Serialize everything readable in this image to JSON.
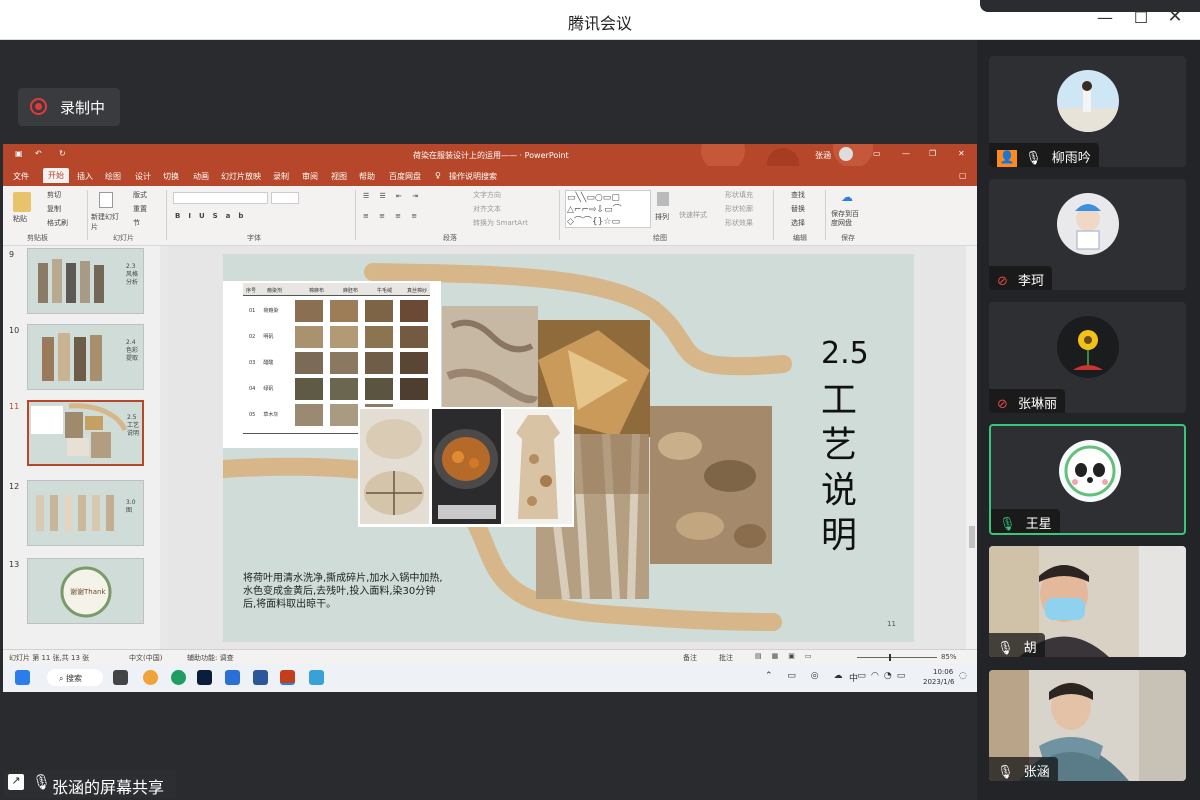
{
  "app": {
    "window_title": "腾讯会议",
    "recording_label": "录制中",
    "share_label": "张涵的屏幕共享"
  },
  "ppt": {
    "title": "荷染在服装设计上的运用—— · PowerPoint",
    "user": "张涵",
    "tabs": [
      "文件",
      "开始",
      "插入",
      "绘图",
      "设计",
      "切换",
      "动画",
      "幻灯片放映",
      "录制",
      "审阅",
      "视图",
      "帮助",
      "百度网盘"
    ],
    "search": "操作说明搜索",
    "ribbon": {
      "clipboard_items": [
        "粘贴",
        "剪切",
        "复制",
        "格式刷"
      ],
      "slides_items": [
        "新建幻灯片",
        "版式",
        "重置",
        "节"
      ],
      "para_items": [
        "文字方向",
        "对齐文本",
        "转换为 SmartArt"
      ],
      "drawing_items": [
        "排列",
        "快速样式",
        "形状填充",
        "形状轮廓",
        "形状效果"
      ],
      "edit_items": [
        "查找",
        "替换",
        "选择"
      ],
      "save_item": "保存到百度网盘",
      "groups": [
        "剪贴板",
        "幻灯片",
        "字体",
        "段落",
        "绘图",
        "编辑",
        "保存"
      ]
    },
    "slide_numbers": [
      "9",
      "10",
      "11",
      "12",
      "13"
    ],
    "thumb_texts": [
      "2.3风格分析",
      "2.4色彩提取",
      "2.5工艺说明",
      "3.0图",
      "谢谢Thank"
    ],
    "slide": {
      "heading_num": "2.5",
      "heading_chars": [
        "工",
        "艺",
        "说",
        "明"
      ],
      "table_headers": [
        "序号",
        "瘾染剂",
        "棉麻布",
        "麻胚布",
        "牛毛绒",
        "真丝棉纱"
      ],
      "table_rows": [
        [
          "01",
          "荷瘾染"
        ],
        [
          "02",
          "明矾"
        ],
        [
          "03",
          "醋酸"
        ],
        [
          "04",
          "绿矾"
        ],
        [
          "05",
          "草木灰"
        ]
      ],
      "body_text": "将荷叶用清水洗净,撕成碎片,加水入锅中加热,水色变成金黄后,去残叶,投入面料,染30分钟后,将面料取出晾干。",
      "page_num": "11"
    },
    "status": {
      "left": "幻灯片 第 11 张,共 13 张",
      "lang": "中文(中国)",
      "access": "辅助功能: 调查",
      "notes": "备注",
      "comments": "批注",
      "zoom": "85%"
    },
    "taskbar": {
      "search": "搜索",
      "time": "10:06",
      "date": "2023/1/6",
      "ime": "中"
    }
  },
  "participants": [
    {
      "name": "柳雨吟",
      "mic": "on",
      "host": true
    },
    {
      "name": "李珂",
      "mic": "muted"
    },
    {
      "name": "张琳丽",
      "mic": "muted"
    },
    {
      "name": "王星",
      "mic": "speaking",
      "active": true
    },
    {
      "name": "胡",
      "mic": "on"
    },
    {
      "name": "张涵",
      "mic": "on"
    }
  ],
  "colors": {
    "ppt_accent": "#b7472a",
    "slide_bg": "#cfdcd8",
    "brush_stroke": "#d7b68a",
    "active_speaker": "#36c77a",
    "record_red": "#e03a3a"
  }
}
